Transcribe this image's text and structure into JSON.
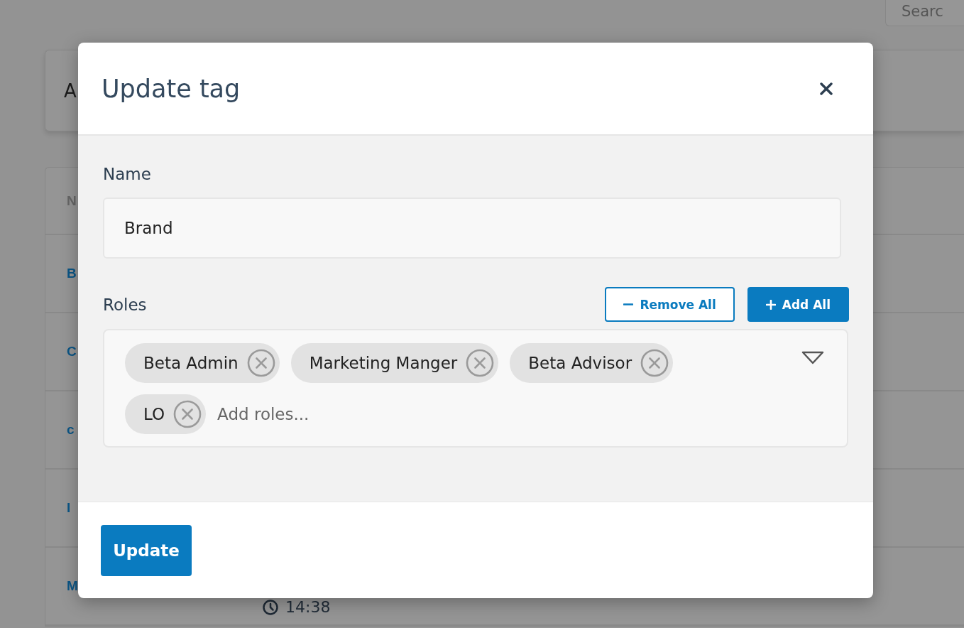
{
  "page": {
    "search": {
      "placeholder": "Searc"
    },
    "header_card": {
      "text": "A"
    },
    "table": {
      "columns": [
        "N"
      ],
      "rows": [
        {
          "cells": [
            "B"
          ]
        },
        {
          "cells": [
            "C"
          ]
        },
        {
          "cells": [
            "c"
          ]
        },
        {
          "cells": [
            "I"
          ]
        },
        {
          "cells": [
            "M"
          ],
          "time": "14:38"
        }
      ]
    }
  },
  "dialog": {
    "title": "Update tag",
    "name_field": {
      "label": "Name",
      "value": "Brand"
    },
    "roles_field": {
      "label": "Roles",
      "actions": [
        {
          "kind": "remove",
          "label": "Remove All"
        },
        {
          "kind": "add",
          "label": "Add All"
        }
      ],
      "tags": [
        "Beta Admin",
        "Marketing Manger",
        "Beta Advisor",
        "LO"
      ],
      "placeholder": "Add roles..."
    },
    "buttons": [
      "Update"
    ]
  }
}
